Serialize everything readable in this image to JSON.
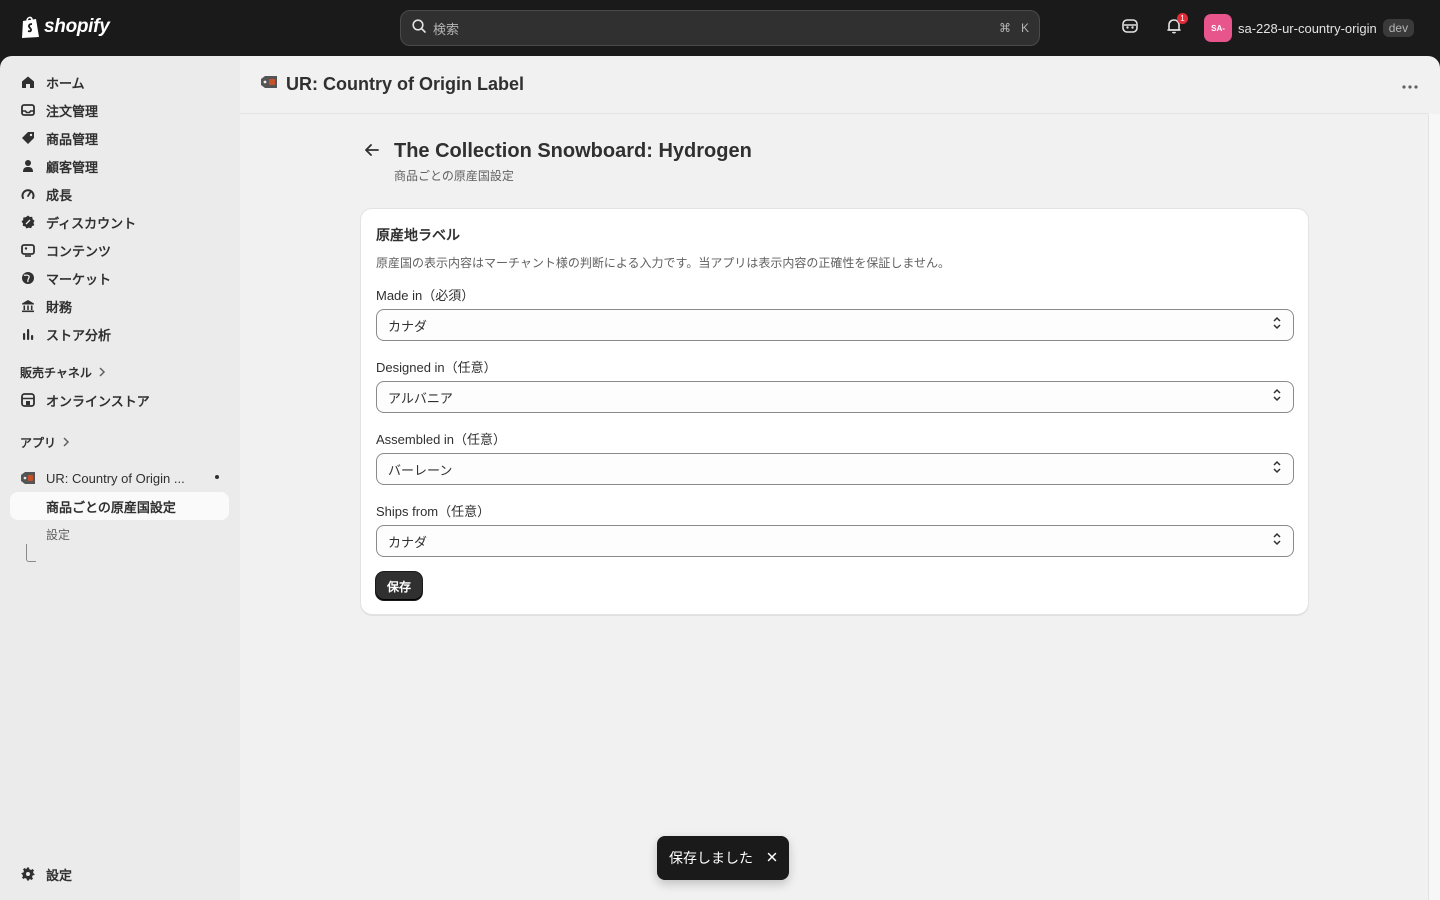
{
  "topbar": {
    "logo_text": "shopify",
    "search_placeholder": "検索",
    "shortcut_cmd": "⌘",
    "shortcut_key": "K",
    "notification_count": "1",
    "avatar_initials": "SA-",
    "store_name": "sa-228-ur-country-origin",
    "store_badge": "dev"
  },
  "sidebar": {
    "items": [
      {
        "label": "ホーム",
        "icon": "home-icon"
      },
      {
        "label": "注文管理",
        "icon": "inbox-icon"
      },
      {
        "label": "商品管理",
        "icon": "tag-icon"
      },
      {
        "label": "顧客管理",
        "icon": "person-icon"
      },
      {
        "label": "成長",
        "icon": "gauge-icon"
      },
      {
        "label": "ディスカウント",
        "icon": "discount-icon"
      },
      {
        "label": "コンテンツ",
        "icon": "content-icon"
      },
      {
        "label": "マーケット",
        "icon": "globe-icon"
      },
      {
        "label": "財務",
        "icon": "bank-icon"
      },
      {
        "label": "ストア分析",
        "icon": "chart-bar-icon"
      }
    ],
    "sales_channels_label": "販売チャネル",
    "online_store_label": "オンラインストア",
    "apps_label": "アプリ",
    "app_name": "UR: Country of Origin ...",
    "app_sub_active": "商品ごとの原産国設定",
    "app_sub_settings": "設定",
    "settings_label": "設定"
  },
  "app_header": {
    "title": "UR: Country of Origin Label"
  },
  "page": {
    "title": "The Collection Snowboard: Hydrogen",
    "subtitle": "商品ごとの原産国設定"
  },
  "card": {
    "title": "原産地ラベル",
    "description": "原産国の表示内容はマーチャント様の判断による入力です。当アプリは表示内容の正確性を保証しません。",
    "fields": [
      {
        "label": "Made in（必須）",
        "value": "カナダ"
      },
      {
        "label": "Designed in（任意）",
        "value": "アルバニア"
      },
      {
        "label": "Assembled in（任意）",
        "value": "バーレーン"
      },
      {
        "label": "Ships from（任意）",
        "value": "カナダ"
      }
    ],
    "save_label": "保存"
  },
  "toast": {
    "message": "保存しました"
  },
  "colors": {
    "topbar_bg": "#1a1a1a",
    "sidebar_bg": "#ebebeb",
    "main_bg": "#f1f1f1",
    "primary_button": "#303030",
    "avatar_bg": "#e8558c",
    "notification_badge": "#e22c38"
  }
}
